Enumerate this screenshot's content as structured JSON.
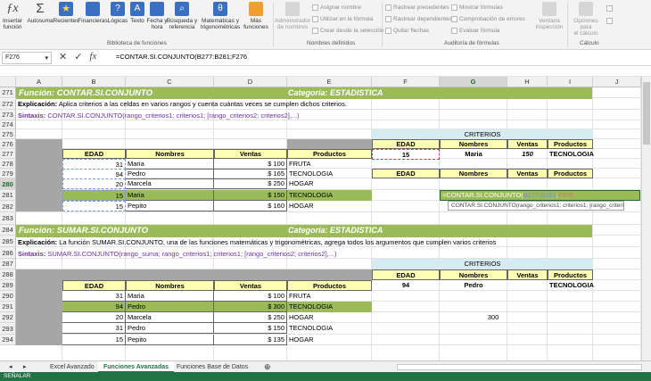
{
  "ribbon": {
    "buttons": [
      {
        "l1": "Insertar",
        "l2": "función",
        "icon": "fx-icon"
      },
      {
        "l1": "Autosuma",
        "l2": "",
        "icon": "sigma-icon"
      },
      {
        "l1": "Recientes",
        "l2": "",
        "icon": "star-icon"
      },
      {
        "l1": "Financieras",
        "l2": "",
        "icon": "book-icon"
      },
      {
        "l1": "Lógicas",
        "l2": "",
        "icon": "question-icon"
      },
      {
        "l1": "Texto",
        "l2": "",
        "icon": "text-icon"
      },
      {
        "l1": "Fecha y",
        "l2": "hora",
        "icon": "calendar-icon"
      },
      {
        "l1": "Búsqueda y",
        "l2": "referencia",
        "icon": "search-icon"
      },
      {
        "l1": "Matemáticas y",
        "l2": "trigonométricas",
        "icon": "theta-icon"
      },
      {
        "l1": "Más",
        "l2": "funciones",
        "icon": "more-icon"
      },
      {
        "l1": "Administrador",
        "l2": "de nombres",
        "icon": "name-manager-icon"
      }
    ],
    "small": [
      "Asignar nombre",
      "Utilizar en la fórmula",
      "Crear desde la selección",
      "Rastrear precedentes",
      "Rastrear dependientes",
      "Quitar flechas",
      "Mostrar fórmulas",
      "Comprobación de errores",
      "Evaluar fórmula",
      "Ventana",
      "Inspección",
      "Opciones para",
      "el cálculo"
    ],
    "groups": [
      "Biblioteca de funciones",
      "Nombres definidos",
      "Auditoría de fórmulas",
      "Cálculo"
    ]
  },
  "formula_bar": {
    "name_box": "F276",
    "formula": "=CONTAR.SI.CONJUNTO(B277:B281;F276"
  },
  "columns": [
    "A",
    "B",
    "C",
    "D",
    "E",
    "F",
    "G",
    "H",
    "I",
    "J"
  ],
  "rows": [
    "271",
    "272",
    "273",
    "274",
    "275",
    "276",
    "277",
    "278",
    "279",
    "280",
    "281",
    "282",
    "283",
    "284",
    "285",
    "286",
    "287",
    "288",
    "289",
    "290",
    "291",
    "292",
    "293",
    "294"
  ],
  "sec1": {
    "title": "Función: CONTAR.SI.CONJUNTO",
    "category": "Categoría: ESTADISTICA",
    "exp_label": "Explicación:",
    "exp_text": "Aplica criterios a las celdas en varios rangos y cuenta cuántas veces se cumplen dichos criterios.",
    "syn_label": "Sintaxis:",
    "syn_text": "CONTAR.SI.CONJUNTO(rango_criterios1; criterios1; [rango_criterios2; criterios2],...)",
    "headers": [
      "EDAD",
      "Nombres",
      "Ventas",
      "Productos"
    ],
    "rows": [
      [
        "31",
        "Maria",
        "$ 100",
        "FRUTA"
      ],
      [
        "94",
        "Pedro",
        "$ 165",
        "TECNOLOGIA"
      ],
      [
        "20",
        "Marcela",
        "$ 250",
        "HOGAR"
      ],
      [
        "15",
        "Maria",
        "$ 150",
        "TECNOLOGIA"
      ],
      [
        "15",
        "Pepito",
        "$ 160",
        "HOGAR"
      ]
    ],
    "criteria_title": "CRITERIOS",
    "criteria_headers": [
      "EDAD",
      "Nombres",
      "Ventas",
      "Productos"
    ],
    "criteria_values": [
      "15",
      "Maria",
      "150",
      "TECNOLOGIA"
    ],
    "criteria_headers2": [
      "EDAD",
      "Nombres",
      "Ventas",
      "Productos"
    ],
    "edit_formula_a": "=CONTAR.SI.CONJUNTO(",
    "edit_formula_b": "B277:B281",
    "edit_formula_c": ";",
    "edit_formula_d": "F276",
    "tooltip": "CONTAR.SI.CONJUNTO(rango_criterios1; criterios1; [rango_criterios2; ...)"
  },
  "sec2": {
    "title": "Función: SUMAR.SI.CONJUNTO",
    "category": "Categoría: ESTADISTICA",
    "exp_label": "Explicación:",
    "exp_text": "La función SUMAR.SI.CONJUNTO, una de las funciones matemáticas y trigonométricas, agrega todos los argumentos que cumplen varios criterios",
    "syn_label": "Sintaxis:",
    "syn_text": "SUMAR.SI.CONJUNTO(rango_suma; rango_criterios1; criterios1; [rango_criterios2; criterios2],...)",
    "headers": [
      "EDAD",
      "Nombres",
      "Ventas",
      "Productos"
    ],
    "rows": [
      [
        "31",
        "Maria",
        "$ 100",
        "FRUTA"
      ],
      [
        "94",
        "Pedro",
        "$ 300",
        "TECNOLOGIA"
      ],
      [
        "20",
        "Marcela",
        "$ 250",
        "HOGAR"
      ],
      [
        "31",
        "Pedro",
        "$ 150",
        "TECNOLOGIA"
      ],
      [
        "15",
        "Pepito",
        "$ 135",
        "HOGAR"
      ]
    ],
    "criteria_title": "CRITERIOS",
    "criteria_headers": [
      "EDAD",
      "Nombres",
      "Ventas",
      "Productos"
    ],
    "criteria_values": [
      "94",
      "Pedro",
      "",
      "TECNOLOGIA"
    ],
    "result": "300"
  },
  "tabs": [
    "Excel Avanzado",
    "Funciones Avanzadas",
    "Funciones Base de Datos"
  ],
  "status": "SEÑALAR"
}
